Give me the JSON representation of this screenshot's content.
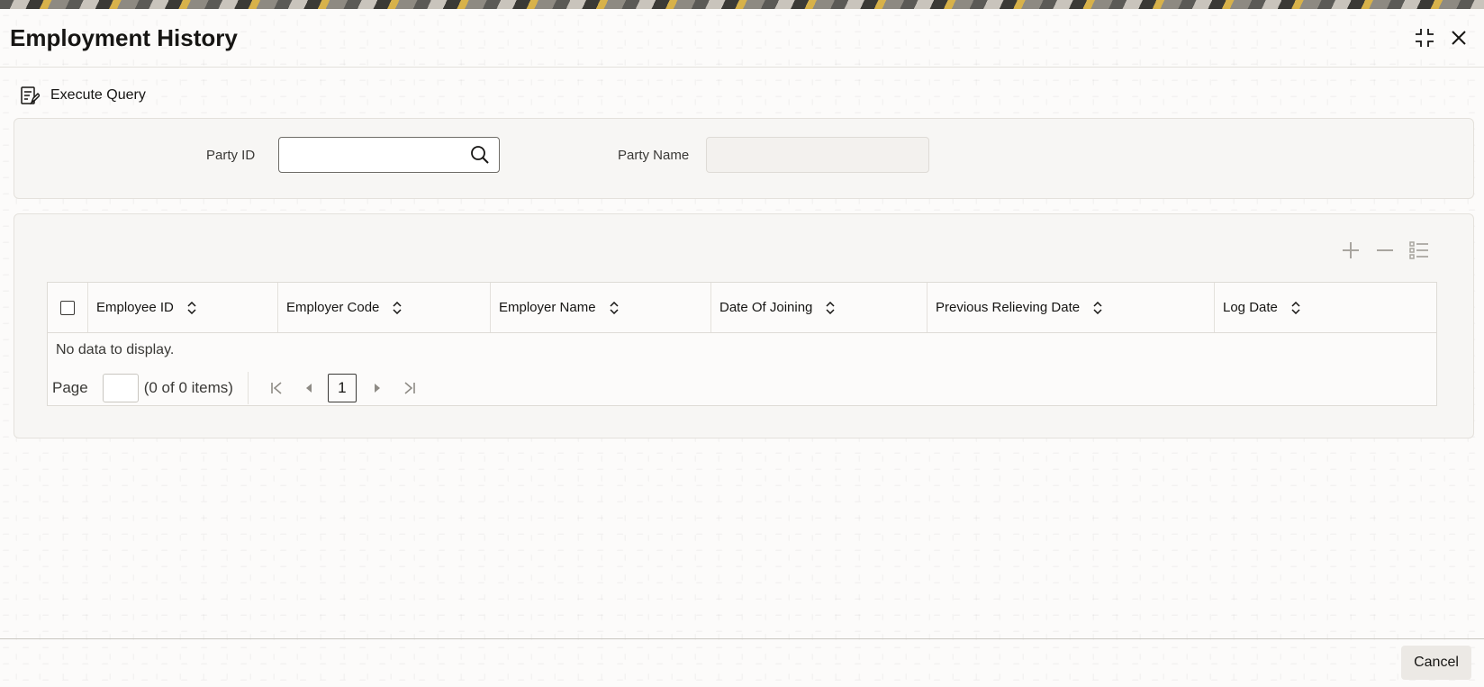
{
  "dialog": {
    "title": "Employment History"
  },
  "toolbar": {
    "execute_query_label": "Execute Query"
  },
  "form": {
    "party_id_label": "Party ID",
    "party_id_value": "",
    "party_name_label": "Party Name",
    "party_name_value": ""
  },
  "table": {
    "columns": [
      "Employee ID",
      "Employer Code",
      "Employer Name",
      "Date Of Joining",
      "Previous Relieving Date",
      "Log Date"
    ],
    "empty_text": "No data to display."
  },
  "pagination": {
    "page_label": "Page",
    "items_text": "(0 of 0 items)",
    "current_page": "1"
  },
  "footer": {
    "cancel_label": "Cancel"
  },
  "colors": {
    "accent": "#161513",
    "panel": "#f7f6f4",
    "border": "#dedbd6"
  }
}
